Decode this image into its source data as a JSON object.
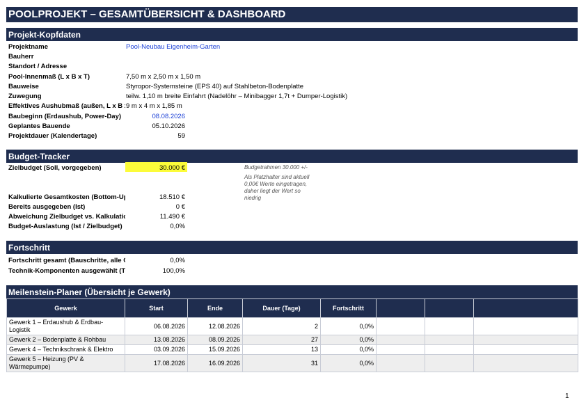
{
  "title": "POOLPROJEKT – GESAMTÜBERSICHT & DASHBOARD",
  "kopf": {
    "header": "Projekt-Kopfdaten",
    "rows": [
      {
        "label": "Projektname",
        "value": "Pool-Neubau Eigenheim-Garten"
      },
      {
        "label": "Bauherr",
        "value": ""
      },
      {
        "label": "Standort / Adresse",
        "value": ""
      },
      {
        "label": "Pool-Innenmaß (L x B x T)",
        "value": "7,50 m x 2,50 m x 1,50 m"
      },
      {
        "label": "Bauweise",
        "value": "Styropor-Systemsteine (EPS 40) auf Stahlbeton-Bodenplatte"
      },
      {
        "label": "Zuwegung",
        "value": "teilw. 1,10 m breite Einfahrt (Nadelöhr – Minibagger 1,7t + Dumper-Logistik)"
      },
      {
        "label": "Effektives Aushubmaß (außen, L x B x T)",
        "value": "9 m x 4 m x 1,85 m"
      },
      {
        "label": "Baubeginn (Erdaushub, Power-Day)",
        "value": "08.08.2026"
      },
      {
        "label": "Geplantes Bauende",
        "value": "05.10.2026"
      },
      {
        "label": "Projektdauer (Kalendertage)",
        "value": "59"
      }
    ]
  },
  "budget": {
    "header": "Budget-Tracker",
    "zielbudget_label": "Zielbudget (Soll, vorgegeben)",
    "zielbudget_value": "30.000 €",
    "note1": "Budgetrahmen 30.000 +/-",
    "note2": [
      "Als Platzhalter sind aktuell",
      "0,00€ Werte eingetragen,",
      "daher liegt der Wert so",
      "niedrig"
    ],
    "rows": [
      {
        "label": "Kalkulierte Gesamtkosten (Bottom-Up)",
        "value": "18.510 €"
      },
      {
        "label": "Bereits ausgegeben (Ist)",
        "value": "0 €"
      },
      {
        "label": "Abweichung Zielbudget vs. Kalkulation",
        "value": "11.490 €"
      },
      {
        "label": "Budget-Auslastung (Ist / Zielbudget)",
        "value": "0,0%"
      }
    ]
  },
  "fortschritt": {
    "header": "Fortschritt",
    "rows": [
      {
        "label": "Fortschritt gesamt (Bauschritte, alle Gewerke)",
        "value": "0,0%"
      },
      {
        "label": "Technik-Komponenten ausgewählt (Technikschrank)",
        "value": "100,0%"
      }
    ]
  },
  "meilenstein": {
    "header": "Meilenstein-Planer (Übersicht je Gewerk)",
    "columns": [
      "Gewerk",
      "Start",
      "Ende",
      "Dauer (Tage)",
      "Fortschritt",
      "",
      "",
      ""
    ],
    "rows": [
      [
        "Gewerk 1 – Erdaushub & Erdbau-Logistik",
        "06.08.2026",
        "12.08.2026",
        "2",
        "0,0%"
      ],
      [
        "Gewerk 2 – Bodenplatte & Rohbau",
        "13.08.2026",
        "08.09.2026",
        "27",
        "0,0%"
      ],
      [
        "Gewerk 4 – Technikschrank & Elektro",
        "03.09.2026",
        "15.09.2026",
        "13",
        "0,0%"
      ],
      [
        "Gewerk 5 – Heizung (PV & Wärmepumpe)",
        "17.08.2026",
        "16.09.2026",
        "31",
        "0,0%"
      ]
    ]
  },
  "page_number": "1"
}
